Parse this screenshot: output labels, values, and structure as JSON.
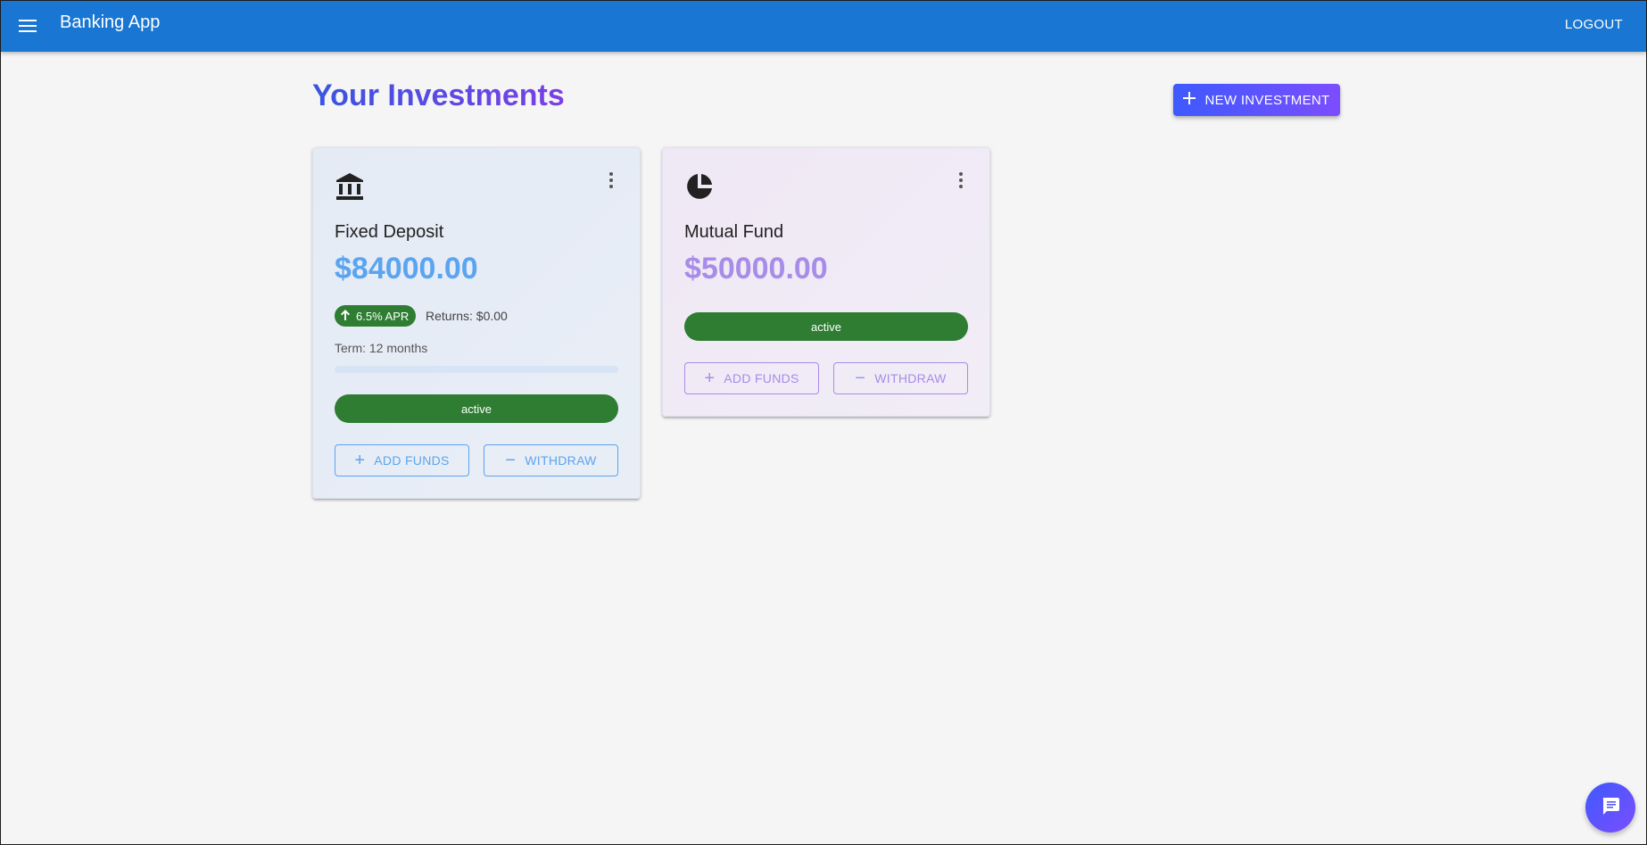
{
  "app": {
    "title": "Banking App",
    "logout_label": "LOGOUT"
  },
  "page": {
    "title": "Your Investments",
    "new_investment_label": "NEW INVESTMENT"
  },
  "investments": [
    {
      "name": "Fixed Deposit",
      "icon": "bank-icon",
      "amount": "$84000.00",
      "apr": "6.5% APR",
      "returns": "Returns: $0.00",
      "term": "Term: 12 months",
      "progress": 0,
      "status": "active",
      "add_funds_label": "ADD FUNDS",
      "withdraw_label": "WITHDRAW",
      "accent": "#5ba4ef"
    },
    {
      "name": "Mutual Fund",
      "icon": "pie-chart-icon",
      "amount": "$50000.00",
      "status": "active",
      "add_funds_label": "ADD FUNDS",
      "withdraw_label": "WITHDRAW",
      "accent": "#a78ce8"
    }
  ],
  "colors": {
    "appbar": "#1976d2",
    "status_active": "#2e7d32",
    "gradient_start": "#3d5afe",
    "gradient_end": "#7c4dff"
  }
}
